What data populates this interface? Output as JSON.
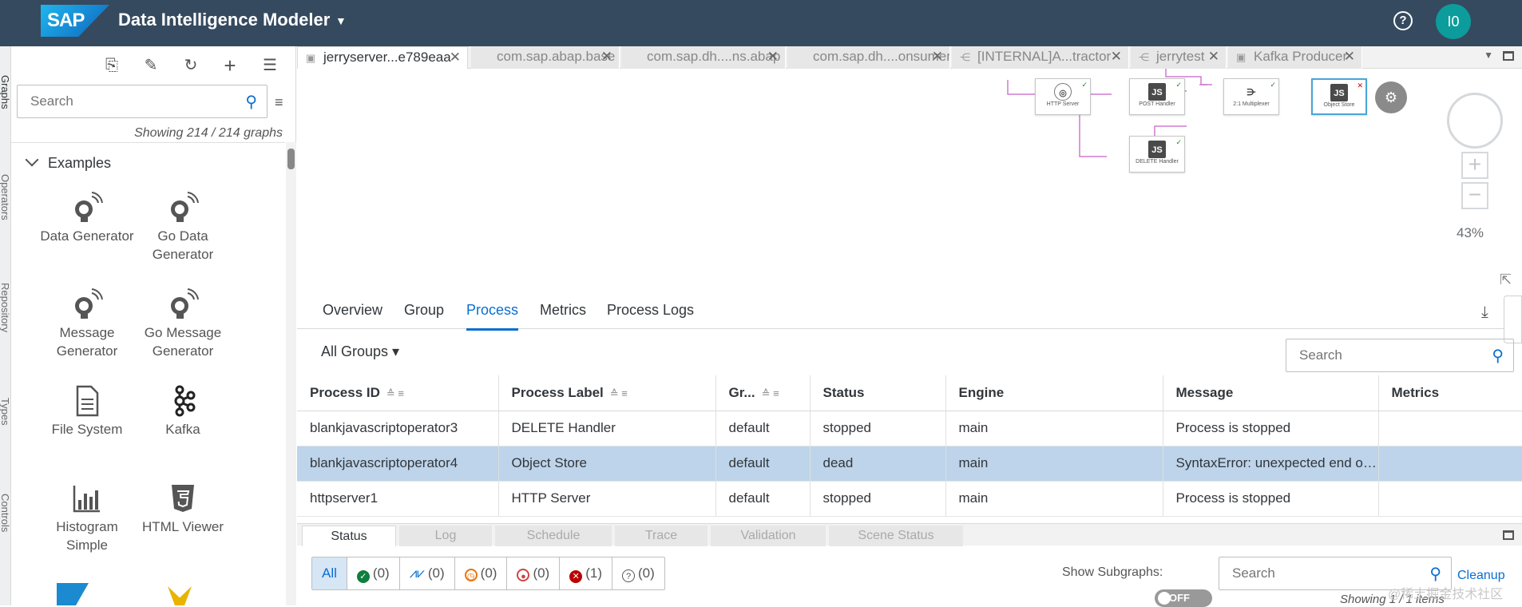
{
  "app": {
    "logo": "SAP",
    "title": "Data Intelligence Modeler",
    "avatar": "I0"
  },
  "vertical_tabs": [
    "Graphs",
    "Operators",
    "Repository",
    "Types",
    "Controls"
  ],
  "sidebar": {
    "search_placeholder": "Search",
    "count": "Showing 214 / 214 graphs",
    "section": "Examples",
    "tiles": [
      {
        "label": "Data Generator",
        "icon": "satellite-dish-icon"
      },
      {
        "label": "Go Data Generator",
        "icon": "satellite-dish-icon"
      },
      {
        "label": "Message Generator",
        "icon": "satellite-dish-icon"
      },
      {
        "label": "Go Message Generator",
        "icon": "satellite-dish-icon"
      },
      {
        "label": "File System",
        "icon": "document-icon"
      },
      {
        "label": "Kafka",
        "icon": "kafka-icon"
      },
      {
        "label": "Histogram Simple",
        "icon": "bar-chart-icon"
      },
      {
        "label": "HTML Viewer",
        "icon": "html5-icon"
      }
    ]
  },
  "editor_tabs": [
    {
      "label": "jerryserver...e789eaa",
      "active": true
    },
    {
      "label": "com.sap.abap.base"
    },
    {
      "label": "com.sap.dh....ns.abap"
    },
    {
      "label": "com.sap.dh....onsumer"
    },
    {
      "label": "[INTERNAL]A...tractor"
    },
    {
      "label": "jerrytest"
    },
    {
      "label": "Kafka Producer"
    }
  ],
  "graph": {
    "nodes": [
      "HTTP Server",
      "POST Handler",
      "2:1 Multiplexer",
      "Object Store",
      "DELETE Handler"
    ],
    "zoom": "43%"
  },
  "process_tabs": [
    "Overview",
    "Group",
    "Process",
    "Metrics",
    "Process Logs"
  ],
  "active_process_tab": "Process",
  "groups_dropdown": "All Groups",
  "table_search_placeholder": "Search",
  "process_table": {
    "columns": [
      "Process ID",
      "Process Label",
      "Gr...",
      "Status",
      "Engine",
      "Message",
      "Metrics"
    ],
    "rows": [
      [
        "blankjavascriptoperator3",
        "DELETE Handler",
        "default",
        "stopped",
        "main",
        "Process is stopped",
        ""
      ],
      [
        "blankjavascriptoperator4",
        "Object Store",
        "default",
        "dead",
        "main",
        "SyntaxError: unexpected end of ...",
        ""
      ],
      [
        "httpserver1",
        "HTTP Server",
        "default",
        "stopped",
        "main",
        "Process is stopped",
        ""
      ]
    ],
    "selected_row": 1
  },
  "bottom_tabs": [
    "Status",
    "Log",
    "Schedule",
    "Trace",
    "Validation",
    "Scene Status"
  ],
  "status_filters": {
    "all": "All",
    "counts": [
      "(0)",
      "(0)",
      "(0)",
      "(0)",
      "(1)",
      "(0)"
    ]
  },
  "show_subgraphs": "Show Subgraphs:",
  "toggle": "OFF",
  "status_search_placeholder": "Search",
  "cleanup": "Cleanup",
  "showing_items": "Showing 1 / 1 items",
  "watermark": "@稀土掘金技术社区",
  "colors": {
    "shell": "#354a5f",
    "accent": "#0a6ed1",
    "selected_row": "#bdd4ea"
  }
}
